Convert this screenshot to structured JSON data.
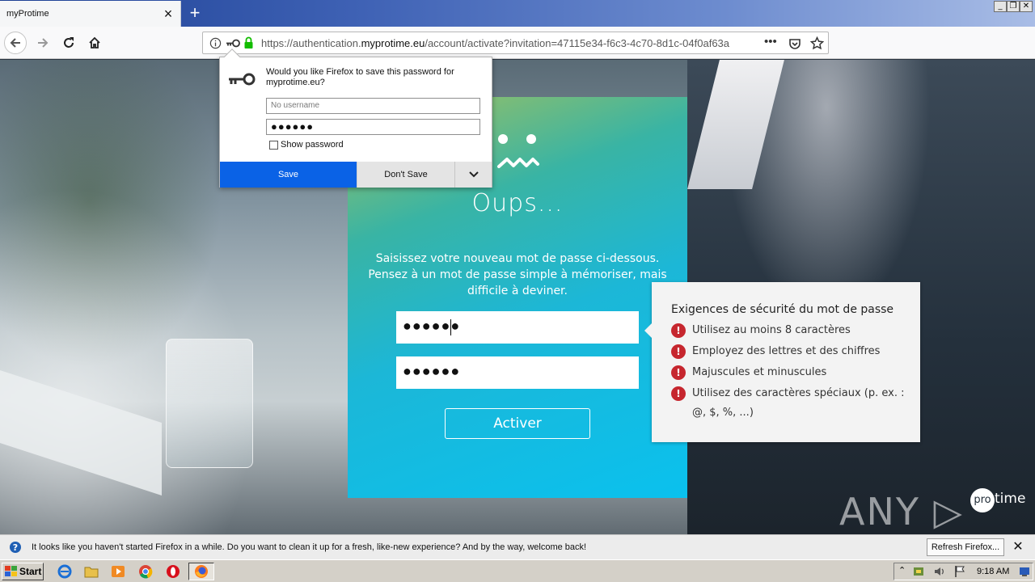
{
  "window": {
    "tab_title": "myProtime",
    "controls": [
      "_",
      "❐",
      "✕"
    ]
  },
  "nav": {
    "url_prefix": "https://authentication.",
    "url_domain": "myprotime.eu",
    "url_rest": "/account/activate?invitation=47115e34-f6c3-4c70-8d1c-04f0af63a"
  },
  "page": {
    "heading": "Oups...",
    "instructions": "Saisissez votre nouveau mot de passe ci-dessous. Pensez à un mot de passe simple à mémoriser, mais difficile à deviner.",
    "password_value": "●●●●●●",
    "confirm_value": "●●●●●●",
    "activate_label": "Activer"
  },
  "requirements": {
    "title": "Exigences de sécurité du mot de passe",
    "items": [
      "Utilisez au moins 8 caractères",
      "Employez des lettres et des chiffres",
      "Majuscules et minuscules",
      "Utilisez des caractères spéciaux (p. ex. : @, $, %, ...)"
    ]
  },
  "doorhanger": {
    "question": "Would you like Firefox to save this password for myprotime.eu?",
    "username_placeholder": "No username",
    "password_value": "●●●●●●",
    "show_password_label": "Show password",
    "save_label": "Save",
    "dont_save_label": "Don't Save"
  },
  "notification": {
    "text": "It looks like you haven't started Firefox in a while. Do you want to clean it up for a fresh, like-new experience? And by the way, welcome back!",
    "refresh_label": "Refresh Firefox..."
  },
  "watermark": {
    "text": "ANY ▷ RUN",
    "logo_pro": "pro",
    "logo_time": "time"
  },
  "taskbar": {
    "start_label": "Start",
    "clock": "9:18 AM"
  },
  "colors": {
    "save_button": "#0a62e6",
    "error_icon": "#c6262e",
    "card_top": "#a6c15c",
    "card_bottom": "#0ac1ee"
  }
}
